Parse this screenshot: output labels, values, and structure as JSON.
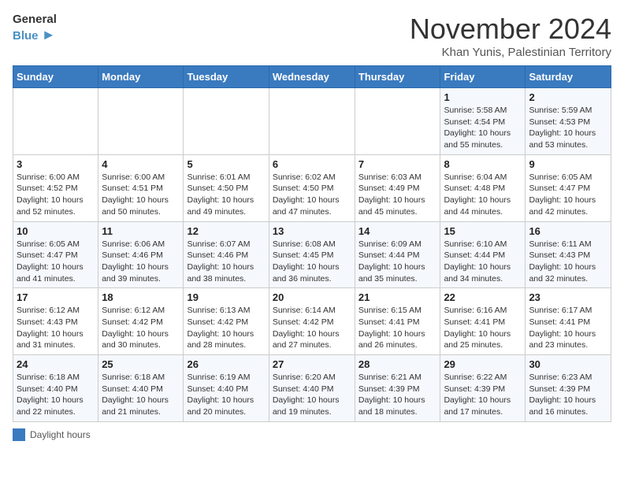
{
  "header": {
    "logo_line1": "General",
    "logo_line2": "Blue",
    "month_title": "November 2024",
    "location": "Khan Yunis, Palestinian Territory"
  },
  "days_of_week": [
    "Sunday",
    "Monday",
    "Tuesday",
    "Wednesday",
    "Thursday",
    "Friday",
    "Saturday"
  ],
  "weeks": [
    [
      {
        "day": "",
        "info": ""
      },
      {
        "day": "",
        "info": ""
      },
      {
        "day": "",
        "info": ""
      },
      {
        "day": "",
        "info": ""
      },
      {
        "day": "",
        "info": ""
      },
      {
        "day": "1",
        "info": "Sunrise: 5:58 AM\nSunset: 4:54 PM\nDaylight: 10 hours and 55 minutes."
      },
      {
        "day": "2",
        "info": "Sunrise: 5:59 AM\nSunset: 4:53 PM\nDaylight: 10 hours and 53 minutes."
      }
    ],
    [
      {
        "day": "3",
        "info": "Sunrise: 6:00 AM\nSunset: 4:52 PM\nDaylight: 10 hours and 52 minutes."
      },
      {
        "day": "4",
        "info": "Sunrise: 6:00 AM\nSunset: 4:51 PM\nDaylight: 10 hours and 50 minutes."
      },
      {
        "day": "5",
        "info": "Sunrise: 6:01 AM\nSunset: 4:50 PM\nDaylight: 10 hours and 49 minutes."
      },
      {
        "day": "6",
        "info": "Sunrise: 6:02 AM\nSunset: 4:50 PM\nDaylight: 10 hours and 47 minutes."
      },
      {
        "day": "7",
        "info": "Sunrise: 6:03 AM\nSunset: 4:49 PM\nDaylight: 10 hours and 45 minutes."
      },
      {
        "day": "8",
        "info": "Sunrise: 6:04 AM\nSunset: 4:48 PM\nDaylight: 10 hours and 44 minutes."
      },
      {
        "day": "9",
        "info": "Sunrise: 6:05 AM\nSunset: 4:47 PM\nDaylight: 10 hours and 42 minutes."
      }
    ],
    [
      {
        "day": "10",
        "info": "Sunrise: 6:05 AM\nSunset: 4:47 PM\nDaylight: 10 hours and 41 minutes."
      },
      {
        "day": "11",
        "info": "Sunrise: 6:06 AM\nSunset: 4:46 PM\nDaylight: 10 hours and 39 minutes."
      },
      {
        "day": "12",
        "info": "Sunrise: 6:07 AM\nSunset: 4:46 PM\nDaylight: 10 hours and 38 minutes."
      },
      {
        "day": "13",
        "info": "Sunrise: 6:08 AM\nSunset: 4:45 PM\nDaylight: 10 hours and 36 minutes."
      },
      {
        "day": "14",
        "info": "Sunrise: 6:09 AM\nSunset: 4:44 PM\nDaylight: 10 hours and 35 minutes."
      },
      {
        "day": "15",
        "info": "Sunrise: 6:10 AM\nSunset: 4:44 PM\nDaylight: 10 hours and 34 minutes."
      },
      {
        "day": "16",
        "info": "Sunrise: 6:11 AM\nSunset: 4:43 PM\nDaylight: 10 hours and 32 minutes."
      }
    ],
    [
      {
        "day": "17",
        "info": "Sunrise: 6:12 AM\nSunset: 4:43 PM\nDaylight: 10 hours and 31 minutes."
      },
      {
        "day": "18",
        "info": "Sunrise: 6:12 AM\nSunset: 4:42 PM\nDaylight: 10 hours and 30 minutes."
      },
      {
        "day": "19",
        "info": "Sunrise: 6:13 AM\nSunset: 4:42 PM\nDaylight: 10 hours and 28 minutes."
      },
      {
        "day": "20",
        "info": "Sunrise: 6:14 AM\nSunset: 4:42 PM\nDaylight: 10 hours and 27 minutes."
      },
      {
        "day": "21",
        "info": "Sunrise: 6:15 AM\nSunset: 4:41 PM\nDaylight: 10 hours and 26 minutes."
      },
      {
        "day": "22",
        "info": "Sunrise: 6:16 AM\nSunset: 4:41 PM\nDaylight: 10 hours and 25 minutes."
      },
      {
        "day": "23",
        "info": "Sunrise: 6:17 AM\nSunset: 4:41 PM\nDaylight: 10 hours and 23 minutes."
      }
    ],
    [
      {
        "day": "24",
        "info": "Sunrise: 6:18 AM\nSunset: 4:40 PM\nDaylight: 10 hours and 22 minutes."
      },
      {
        "day": "25",
        "info": "Sunrise: 6:18 AM\nSunset: 4:40 PM\nDaylight: 10 hours and 21 minutes."
      },
      {
        "day": "26",
        "info": "Sunrise: 6:19 AM\nSunset: 4:40 PM\nDaylight: 10 hours and 20 minutes."
      },
      {
        "day": "27",
        "info": "Sunrise: 6:20 AM\nSunset: 4:40 PM\nDaylight: 10 hours and 19 minutes."
      },
      {
        "day": "28",
        "info": "Sunrise: 6:21 AM\nSunset: 4:39 PM\nDaylight: 10 hours and 18 minutes."
      },
      {
        "day": "29",
        "info": "Sunrise: 6:22 AM\nSunset: 4:39 PM\nDaylight: 10 hours and 17 minutes."
      },
      {
        "day": "30",
        "info": "Sunrise: 6:23 AM\nSunset: 4:39 PM\nDaylight: 10 hours and 16 minutes."
      }
    ]
  ],
  "legend": {
    "box_color": "#3a7abf",
    "label": "Daylight hours"
  }
}
